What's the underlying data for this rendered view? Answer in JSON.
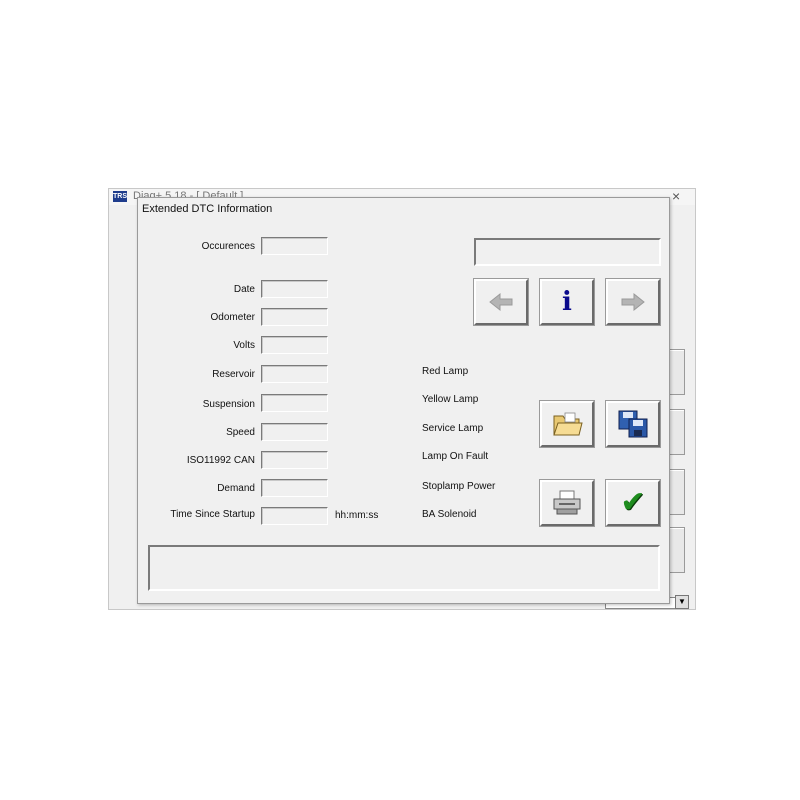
{
  "background_window": {
    "title": "Diag+ 5.18 - [ Default ]",
    "logo": "TRS",
    "close": "×"
  },
  "dialog": {
    "title": "Extended DTC Information",
    "fields": [
      {
        "label": "Occurences"
      },
      {
        "label": "Date"
      },
      {
        "label": "Odometer"
      },
      {
        "label": "Volts"
      },
      {
        "label": "Reservoir"
      },
      {
        "label": "Suspension"
      },
      {
        "label": "Speed"
      },
      {
        "label": "ISO11992 CAN"
      },
      {
        "label": "Demand"
      },
      {
        "label": "Time Since Startup",
        "unit": "hh:mm:ss"
      }
    ],
    "status_labels": [
      "Red Lamp",
      "Yellow Lamp",
      "Service Lamp",
      "Lamp On Fault",
      "Stoplamp Power",
      "BA Solenoid"
    ],
    "buttons": {
      "prev_icon": "arrow-left-icon",
      "info_icon": "info-icon",
      "next_icon": "arrow-right-icon",
      "open_icon": "folder-icon",
      "save_icon": "floppy-disks-icon",
      "print_icon": "printer-icon",
      "ok_icon": "checkmark-icon"
    },
    "colors": {
      "info": "#0a0a8c",
      "check": "#1e8c1e",
      "arrow": "#b4b4b4"
    }
  }
}
